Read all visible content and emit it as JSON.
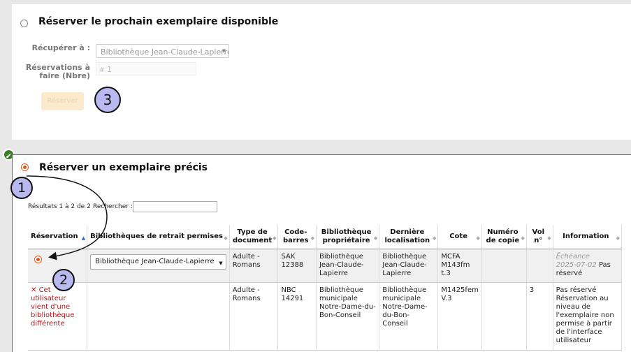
{
  "next_available": {
    "heading": "Réserver le prochain exemplaire disponible",
    "pickup_label": "Récupérer à :",
    "pickup_value": "Bibliothèque Jean-Claude-Lapierre",
    "holds_label_line1": "Réservations à",
    "holds_label_line2": "faire (Nbre)",
    "holds_value": "1",
    "submit_label": "Réserver"
  },
  "specific_item": {
    "heading": "Réserver un exemplaire précis",
    "results_info": "Résultats 1 à 2 de 2",
    "search_label": "Rechercher :",
    "columns": [
      {
        "l1": "Réservation",
        "l2": ""
      },
      {
        "l1": "Bibliothèques de retrait permises",
        "l2": ""
      },
      {
        "l1": "Type de",
        "l2": "document"
      },
      {
        "l1": "Code-",
        "l2": "barres"
      },
      {
        "l1": "Bibliothèque",
        "l2": "propriétaire"
      },
      {
        "l1": "Dernière",
        "l2": "localisation"
      },
      {
        "l1": "Cote",
        "l2": ""
      },
      {
        "l1": "Numéro",
        "l2": "de copie"
      },
      {
        "l1": "Vol",
        "l2": "n°"
      },
      {
        "l1": "Information",
        "l2": ""
      }
    ],
    "rows": [
      {
        "pickup": "Bibliothèque Jean-Claude-Lapierre",
        "itype": "Adulte -\nRomans",
        "barcode": "SAK\n12388",
        "home": "Bibliothèque\nJean-Claude-\nLapierre",
        "location": "Bibliothèque\nJean-Claude-\nLapierre",
        "callnumber": "MCFA\nM143fm\nt.3",
        "copy": "",
        "vol": "",
        "due": "Échéance\n2025-07-02",
        "info": "Pas réservé"
      },
      {
        "error_icon": "✕",
        "error": "Cet utilisateur vient d'une bibliothèque différente",
        "itype": "Adulte -\nRomans",
        "barcode": "NBC\n14291",
        "home": "Bibliothèque\nmunicipale\nNotre-Dame-du-\nBon-Conseil",
        "location": "Bibliothèque\nmunicipale\nNotre-Dame-\ndu-Bon-Conseil",
        "callnumber": "M1425fem\nV.3",
        "copy": "",
        "vol": "3",
        "info": "Pas réservé\nRéservation au\nniveau de\nl'exemplaire non\npermise à partir\nde l'interface\nutilisateur"
      }
    ]
  },
  "markers": {
    "one": "1",
    "two": "2",
    "three": "3"
  },
  "check_icon": "✔"
}
